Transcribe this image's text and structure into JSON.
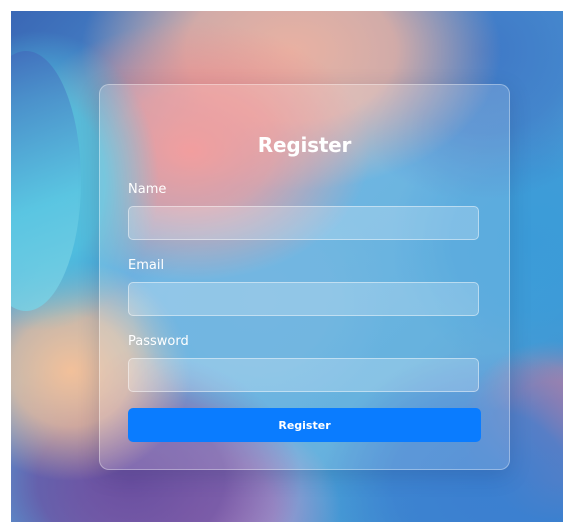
{
  "form": {
    "title": "Register",
    "fields": [
      {
        "label": "Name",
        "value": "",
        "placeholder": ""
      },
      {
        "label": "Email",
        "value": "",
        "placeholder": ""
      },
      {
        "label": "Password",
        "value": "",
        "placeholder": ""
      }
    ],
    "submit_label": "Register"
  },
  "colors": {
    "accent_button": "#0a7cff",
    "text": "#ffffff"
  }
}
